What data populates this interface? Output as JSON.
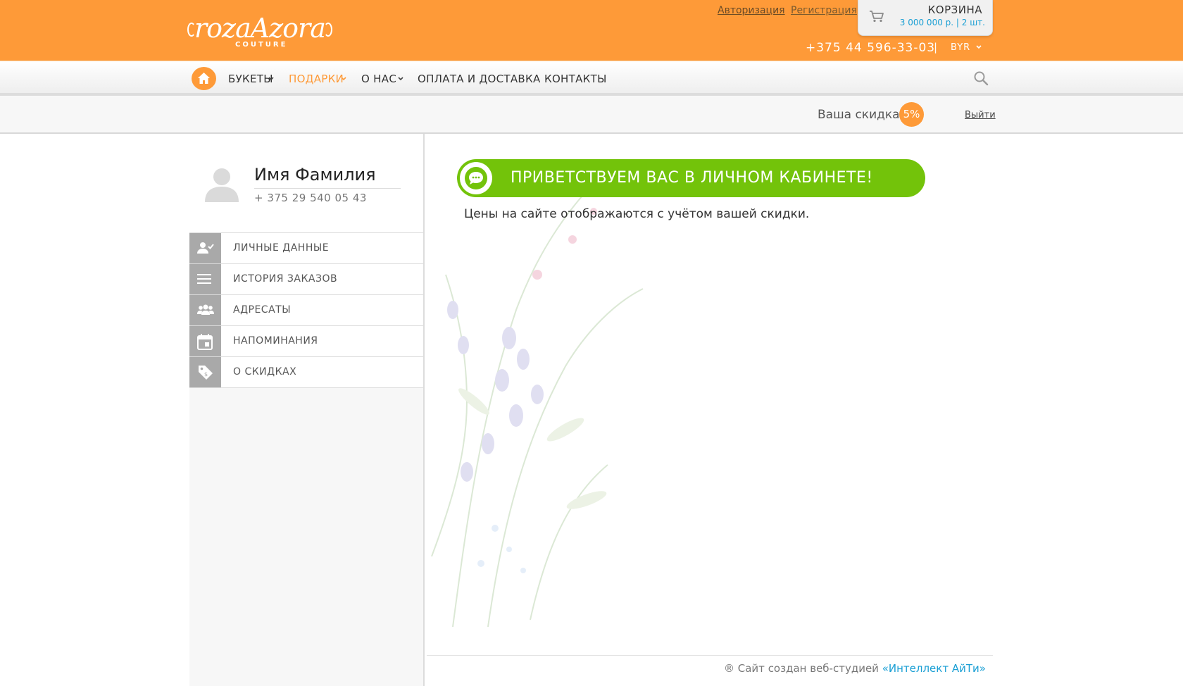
{
  "logo": {
    "main": "rozaAzora",
    "sub": "COUTURE"
  },
  "header": {
    "login": "Авторизация",
    "register": "Регистрация",
    "phone": "+375 44 596-33-03",
    "separator": "|",
    "currency": "BYR"
  },
  "cart": {
    "title": "КОРЗИНА",
    "total": "3 000 000 р. | 2 шт."
  },
  "nav": {
    "items": [
      {
        "label": "БУКЕТЫ",
        "has_dropdown": true,
        "active": false
      },
      {
        "label": "ПОДАРКИ",
        "has_dropdown": true,
        "active": true
      },
      {
        "label": "О НАС",
        "has_dropdown": true,
        "active": false
      },
      {
        "label": "ОПЛАТА И ДОСТАВКА",
        "has_dropdown": false,
        "active": false
      },
      {
        "label": "КОНТАКТЫ",
        "has_dropdown": false,
        "active": false
      }
    ]
  },
  "discount": {
    "label": "Ваша скидка:",
    "value": "5%",
    "logout": "Выйти"
  },
  "profile": {
    "name": "Имя Фамилия",
    "phone": "+ 375 29 540 05 43"
  },
  "menu": [
    {
      "label": "ЛИЧНЫЕ ДАННЫЕ",
      "icon": "user-check-icon"
    },
    {
      "label": "ИСТОРИЯ ЗАКАЗОВ",
      "icon": "list-icon"
    },
    {
      "label": "АДРЕСАТЫ",
      "icon": "group-icon"
    },
    {
      "label": "НАПОМИНАНИЯ",
      "icon": "calendar-icon"
    },
    {
      "label": "О СКИДКАХ",
      "icon": "discount-tag-icon"
    }
  ],
  "welcome": {
    "title": "ПРИВЕТСТВУЕМ ВАС В ЛИЧНОМ КАБИНЕТЕ!",
    "text": "Цены на сайте отображаются с учётом вашей скидки."
  },
  "footer": {
    "prefix": "® Сайт создан веб-студией",
    "link": "«Интеллект АйТи»"
  },
  "colors": {
    "brand_orange": "#fe9a38",
    "welcome_green": "#73c30a",
    "link_blue": "#1a9fd4",
    "menu_icon_bg": "#a9a9a9"
  }
}
